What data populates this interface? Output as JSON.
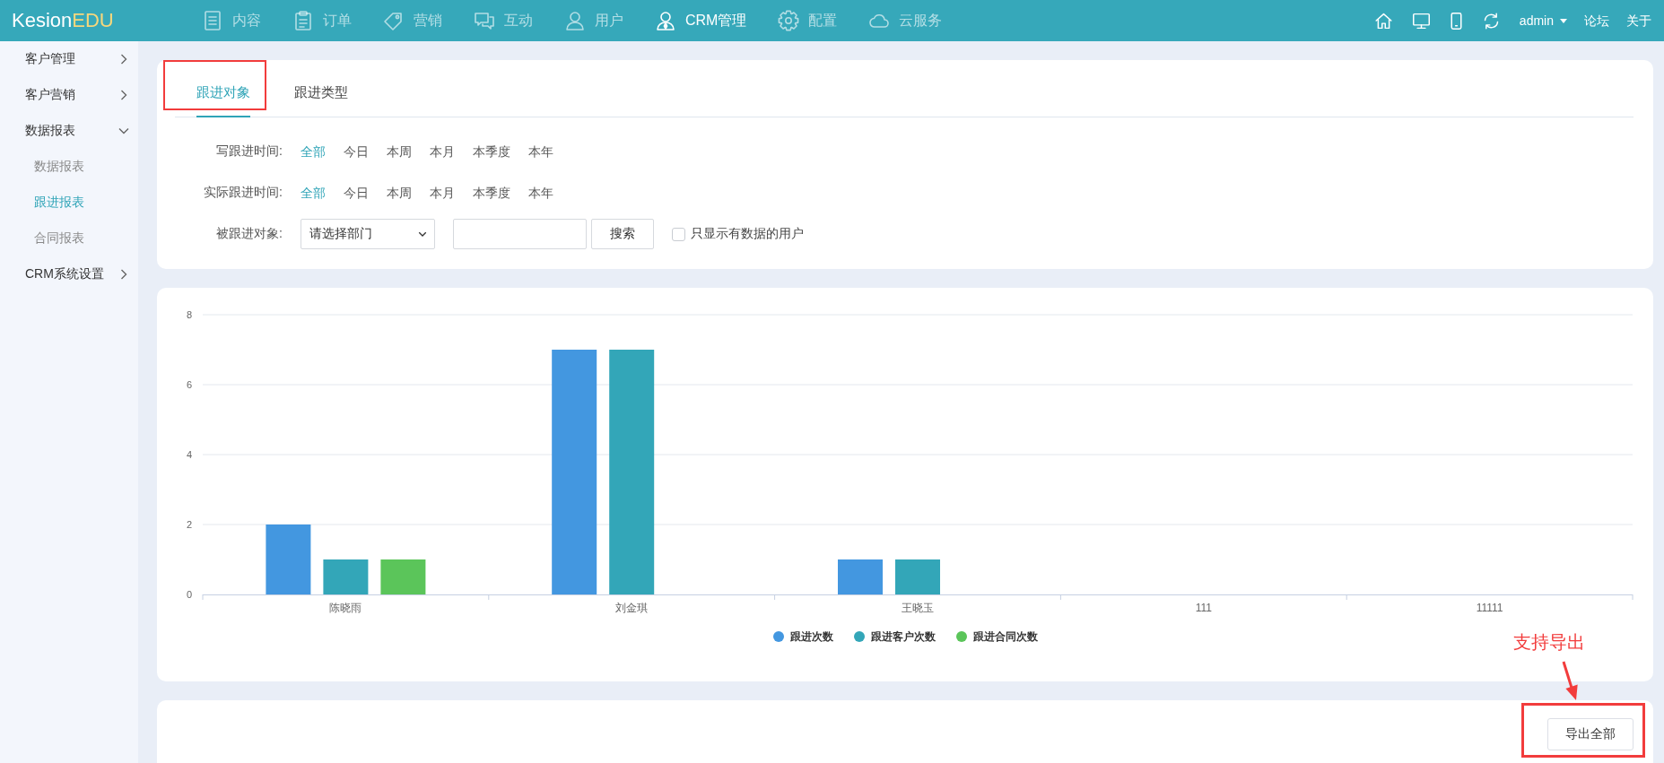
{
  "header": {
    "logo": {
      "text": "Kesion",
      "accent": "EDU"
    },
    "nav": [
      {
        "label": "内容",
        "selected": false
      },
      {
        "label": "订单",
        "selected": false
      },
      {
        "label": "营销",
        "selected": false
      },
      {
        "label": "互动",
        "selected": false
      },
      {
        "label": "用户",
        "selected": false
      },
      {
        "label": "CRM管理",
        "selected": true
      },
      {
        "label": "配置",
        "selected": false
      },
      {
        "label": "云服务",
        "selected": false
      }
    ],
    "user": "admin",
    "links": [
      "论坛",
      "关于"
    ]
  },
  "sidebar": {
    "items": [
      {
        "label": "客户管理",
        "expanded": false
      },
      {
        "label": "客户营销",
        "expanded": false
      },
      {
        "label": "数据报表",
        "expanded": true,
        "children": [
          {
            "label": "数据报表",
            "selected": false
          },
          {
            "label": "跟进报表",
            "selected": true
          },
          {
            "label": "合同报表",
            "selected": false
          }
        ]
      },
      {
        "label": "CRM系统设置",
        "expanded": false
      }
    ]
  },
  "filter_panel": {
    "tabs": [
      {
        "label": "跟进对象",
        "selected": true,
        "highlighted": true
      },
      {
        "label": "跟进类型",
        "selected": false,
        "highlighted": false
      }
    ],
    "time_filters": [
      {
        "label": "写跟进时间:",
        "options": [
          {
            "label": "全部",
            "selected": true
          },
          {
            "label": "今日",
            "selected": false
          },
          {
            "label": "本周",
            "selected": false
          },
          {
            "label": "本月",
            "selected": false
          },
          {
            "label": "本季度",
            "selected": false
          },
          {
            "label": "本年",
            "selected": false
          }
        ]
      },
      {
        "label": "实际跟进时间:",
        "options": [
          {
            "label": "全部",
            "selected": true
          },
          {
            "label": "今日",
            "selected": false
          },
          {
            "label": "本周",
            "selected": false
          },
          {
            "label": "本月",
            "selected": false
          },
          {
            "label": "本季度",
            "selected": false
          },
          {
            "label": "本年",
            "selected": false
          }
        ]
      }
    ],
    "target": {
      "label": "被跟进对象:",
      "select": {
        "value": "请选择部门"
      },
      "search_button": "搜索",
      "only_with_data": {
        "label": "只显示有数据的用户",
        "checked": false
      }
    }
  },
  "chart_panel": {
    "chart_data": {
      "type": "bar",
      "categories": [
        "陈晓雨",
        "刘金琪",
        "王晓玉",
        "111",
        "11111"
      ],
      "series": [
        {
          "name": "跟进次数",
          "color": "#4397e0",
          "values": [
            2,
            7,
            1,
            0,
            0
          ]
        },
        {
          "name": "跟进客户次数",
          "color": "#33a6b8",
          "values": [
            1,
            7,
            1,
            0,
            0
          ]
        },
        {
          "name": "跟进合同次数",
          "color": "#5bc55a",
          "values": [
            1,
            0,
            0,
            0,
            0
          ]
        }
      ],
      "ylim": [
        0,
        8
      ],
      "yticks": [
        0,
        2,
        4,
        6,
        8
      ],
      "grid": true,
      "legend": "bottom"
    }
  },
  "export_panel": {
    "button": {
      "label": "导出全部",
      "highlighted": true
    },
    "callout": "支持导出"
  }
}
